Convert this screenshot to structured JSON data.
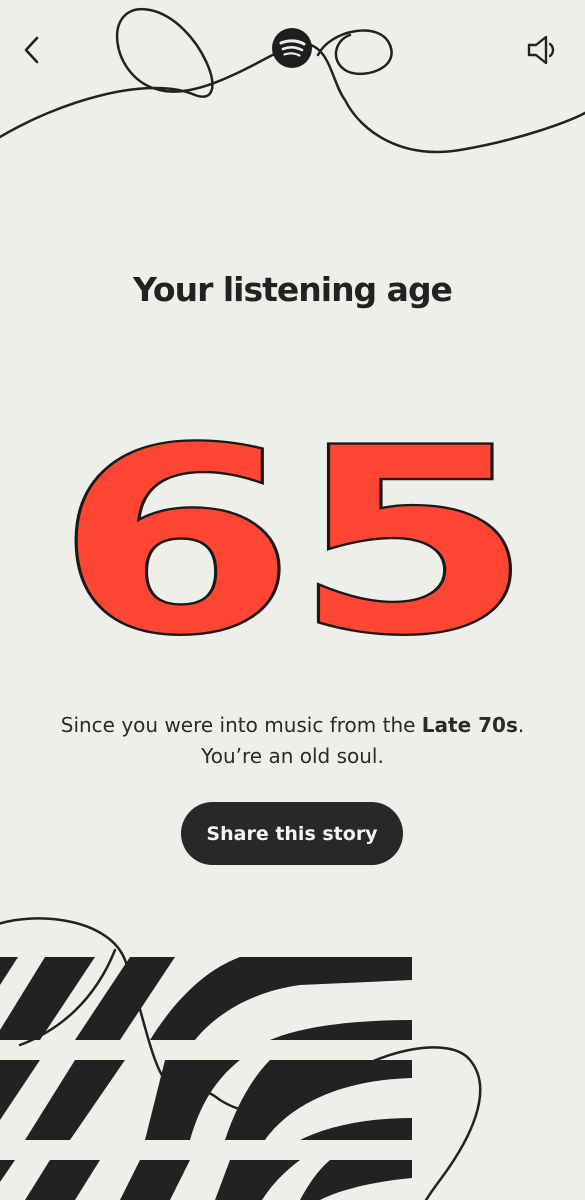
{
  "header": {
    "back_icon": "chevron-left-icon",
    "logo_icon": "spotify-logo-icon",
    "sound_icon": "speaker-muted-icon"
  },
  "story": {
    "title": "Your listening age",
    "age": "65",
    "caption_prefix": "Since you were into music from the ",
    "caption_highlight": "Late 70s",
    "caption_suffix": ". You’re an old soul.",
    "share_label": "Share this story"
  },
  "colors": {
    "background": "#efefea",
    "accent": "#ff4632",
    "ink": "#232323",
    "button": "#282828"
  }
}
